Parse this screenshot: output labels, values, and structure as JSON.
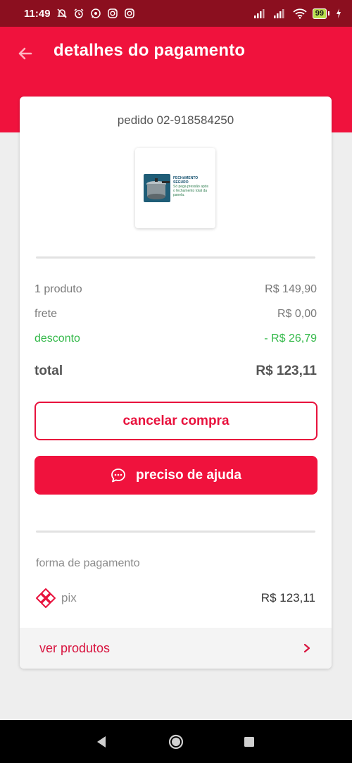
{
  "status_bar": {
    "time": "11:49",
    "battery": "99"
  },
  "header": {
    "title": "detalhes do pagamento"
  },
  "order": {
    "number": "pedido 02-918584250",
    "thumb_title": "FECHAMENTO SEGURO",
    "thumb_body": "Só pega pressão após o fechamento total da panela."
  },
  "summary": {
    "products_label": "1 produto",
    "products_value": "R$ 149,90",
    "shipping_label": "frete",
    "shipping_value": "R$ 0,00",
    "discount_label": "desconto",
    "discount_value": "- R$ 26,79",
    "total_label": "total",
    "total_value": "R$ 123,11"
  },
  "actions": {
    "cancel_label": "cancelar compra",
    "help_label": "preciso de ajuda"
  },
  "payment": {
    "section_label": "forma de pagamento",
    "method": "pix",
    "amount": "R$ 123,11"
  },
  "footer_link": {
    "label": "ver produtos"
  },
  "colors": {
    "brand_red": "#f0123d",
    "status_bar": "#8b0f1f",
    "discount_green": "#34b94a"
  }
}
